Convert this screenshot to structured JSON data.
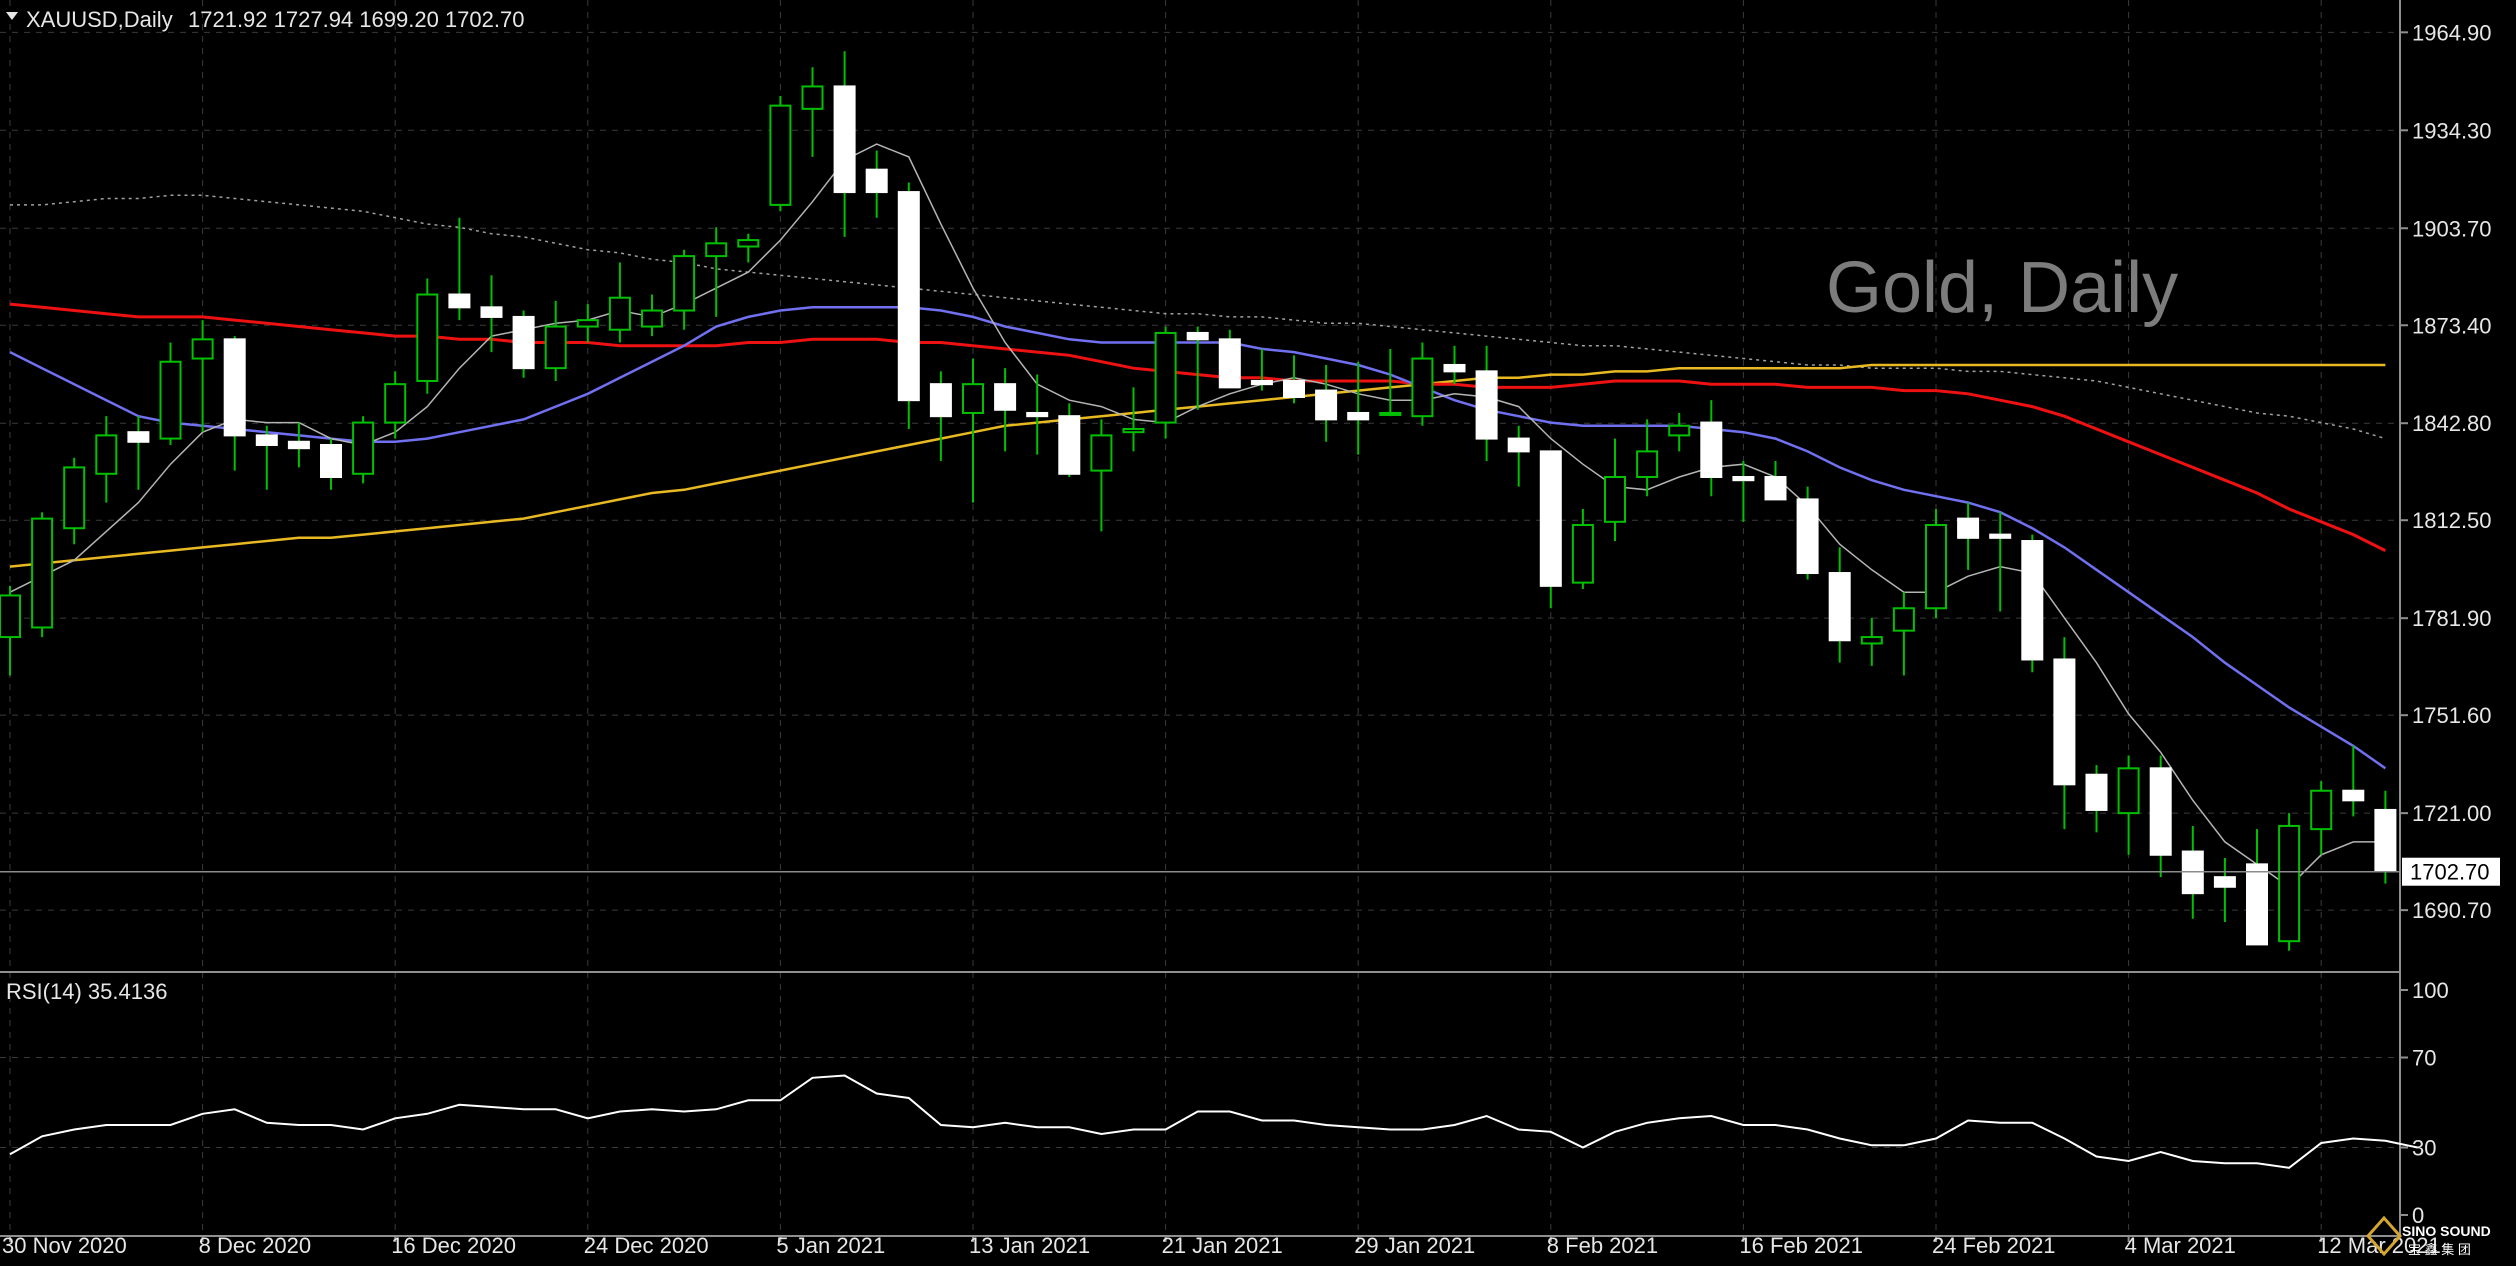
{
  "header": {
    "symbol": "XAUUSD,Daily",
    "ohlc": "1721.92 1727.94 1699.20 1702.70",
    "watermark": "Gold, Daily",
    "last_price": "1702.70"
  },
  "rsi_panel": {
    "label": "RSI(14) 35.4136",
    "levels": [
      "100",
      "70",
      "30",
      "0"
    ]
  },
  "logo": {
    "line1": "SINO SOUND",
    "line2": "宝 鑫 集 团"
  },
  "colors": {
    "background": "#000000",
    "bull_candle": "#000000",
    "bear_candle": "#ffffff",
    "wick": "#00c000",
    "ma_fast": "#b4b4b4",
    "ma_blue": "#7070f0",
    "ma_red": "#ee1111",
    "ma_yellow": "#e8b923",
    "ma_slow_dotted": "#a0a0a0",
    "rsi_line": "#ffffff"
  },
  "chart_data": {
    "type": "candlestick",
    "x_tick_labels": [
      "30 Nov 2020",
      "8 Dec 2020",
      "16 Dec 2020",
      "24 Dec 2020",
      "5 Jan 2021",
      "13 Jan 2021",
      "21 Jan 2021",
      "29 Jan 2021",
      "8 Feb 2021",
      "16 Feb 2021",
      "24 Feb 2021",
      "4 Mar 2021",
      "12 Mar 2021"
    ],
    "x_tick_index": [
      0,
      6,
      12,
      18,
      24,
      30,
      36,
      42,
      48,
      54,
      60,
      66,
      72
    ],
    "y_ticks": [
      1964.9,
      1934.3,
      1903.7,
      1873.4,
      1842.8,
      1812.5,
      1781.9,
      1751.6,
      1721.0,
      1690.7
    ],
    "ylim": [
      1672,
      1975
    ],
    "candles": [
      {
        "o": 1776,
        "h": 1792,
        "l": 1764,
        "c": 1789
      },
      {
        "o": 1779,
        "h": 1815,
        "l": 1776,
        "c": 1813
      },
      {
        "o": 1810,
        "h": 1832,
        "l": 1805,
        "c": 1829
      },
      {
        "o": 1827,
        "h": 1845,
        "l": 1818,
        "c": 1839
      },
      {
        "o": 1840,
        "h": 1845,
        "l": 1822,
        "c": 1837
      },
      {
        "o": 1838,
        "h": 1868,
        "l": 1836,
        "c": 1862
      },
      {
        "o": 1863,
        "h": 1875,
        "l": 1840,
        "c": 1869
      },
      {
        "o": 1869,
        "h": 1870,
        "l": 1828,
        "c": 1839
      },
      {
        "o": 1839,
        "h": 1842,
        "l": 1822,
        "c": 1836
      },
      {
        "o": 1837,
        "h": 1843,
        "l": 1829,
        "c": 1835
      },
      {
        "o": 1836,
        "h": 1838,
        "l": 1822,
        "c": 1826
      },
      {
        "o": 1827,
        "h": 1845,
        "l": 1824,
        "c": 1843
      },
      {
        "o": 1843,
        "h": 1859,
        "l": 1838,
        "c": 1855
      },
      {
        "o": 1856,
        "h": 1888,
        "l": 1852,
        "c": 1883
      },
      {
        "o": 1883,
        "h": 1907,
        "l": 1875,
        "c": 1879
      },
      {
        "o": 1879,
        "h": 1889,
        "l": 1865,
        "c": 1876
      },
      {
        "o": 1876,
        "h": 1878,
        "l": 1857,
        "c": 1860
      },
      {
        "o": 1860,
        "h": 1881,
        "l": 1856,
        "c": 1873
      },
      {
        "o": 1873,
        "h": 1880,
        "l": 1868,
        "c": 1875
      },
      {
        "o": 1872,
        "h": 1893,
        "l": 1868,
        "c": 1882
      },
      {
        "o": 1873,
        "h": 1883,
        "l": 1870,
        "c": 1878
      },
      {
        "o": 1878,
        "h": 1897,
        "l": 1872,
        "c": 1895
      },
      {
        "o": 1895,
        "h": 1904,
        "l": 1876,
        "c": 1899
      },
      {
        "o": 1898,
        "h": 1902,
        "l": 1893,
        "c": 1900
      },
      {
        "o": 1911,
        "h": 1945,
        "l": 1909,
        "c": 1942
      },
      {
        "o": 1941,
        "h": 1954,
        "l": 1926,
        "c": 1948
      },
      {
        "o": 1948,
        "h": 1959,
        "l": 1901,
        "c": 1915
      },
      {
        "o": 1922,
        "h": 1928,
        "l": 1907,
        "c": 1915
      },
      {
        "o": 1915,
        "h": 1918,
        "l": 1841,
        "c": 1850
      },
      {
        "o": 1855,
        "h": 1859,
        "l": 1831,
        "c": 1845
      },
      {
        "o": 1846,
        "h": 1863,
        "l": 1818,
        "c": 1855
      },
      {
        "o": 1855,
        "h": 1860,
        "l": 1834,
        "c": 1847
      },
      {
        "o": 1846,
        "h": 1858,
        "l": 1833,
        "c": 1845
      },
      {
        "o": 1845,
        "h": 1849,
        "l": 1826,
        "c": 1827
      },
      {
        "o": 1828,
        "h": 1844,
        "l": 1809,
        "c": 1839
      },
      {
        "o": 1840,
        "h": 1854,
        "l": 1834,
        "c": 1841
      },
      {
        "o": 1843,
        "h": 1873,
        "l": 1838,
        "c": 1871
      },
      {
        "o": 1871,
        "h": 1873,
        "l": 1847,
        "c": 1869
      },
      {
        "o": 1869,
        "h": 1872,
        "l": 1857,
        "c": 1854
      },
      {
        "o": 1856,
        "h": 1866,
        "l": 1853,
        "c": 1855
      },
      {
        "o": 1856,
        "h": 1864,
        "l": 1849,
        "c": 1851
      },
      {
        "o": 1853,
        "h": 1861,
        "l": 1837,
        "c": 1844
      },
      {
        "o": 1846,
        "h": 1862,
        "l": 1833,
        "c": 1844
      },
      {
        "o": 1846,
        "h": 1866,
        "l": 1845,
        "c": 1846
      },
      {
        "o": 1845,
        "h": 1868,
        "l": 1842,
        "c": 1863
      },
      {
        "o": 1861,
        "h": 1867,
        "l": 1855,
        "c": 1859
      },
      {
        "o": 1859,
        "h": 1867,
        "l": 1831,
        "c": 1838
      },
      {
        "o": 1838,
        "h": 1842,
        "l": 1823,
        "c": 1834
      },
      {
        "o": 1834,
        "h": 1834,
        "l": 1785,
        "c": 1792
      },
      {
        "o": 1793,
        "h": 1816,
        "l": 1791,
        "c": 1811
      },
      {
        "o": 1812,
        "h": 1838,
        "l": 1806,
        "c": 1826
      },
      {
        "o": 1826,
        "h": 1844,
        "l": 1820,
        "c": 1834
      },
      {
        "o": 1839,
        "h": 1846,
        "l": 1834,
        "c": 1842
      },
      {
        "o": 1843,
        "h": 1850,
        "l": 1820,
        "c": 1826
      },
      {
        "o": 1826,
        "h": 1831,
        "l": 1812,
        "c": 1825
      },
      {
        "o": 1826,
        "h": 1831,
        "l": 1819,
        "c": 1819
      },
      {
        "o": 1819,
        "h": 1823,
        "l": 1794,
        "c": 1796
      },
      {
        "o": 1796,
        "h": 1804,
        "l": 1768,
        "c": 1775
      },
      {
        "o": 1774,
        "h": 1782,
        "l": 1767,
        "c": 1776
      },
      {
        "o": 1778,
        "h": 1790,
        "l": 1764,
        "c": 1785
      },
      {
        "o": 1785,
        "h": 1816,
        "l": 1782,
        "c": 1811
      },
      {
        "o": 1813,
        "h": 1818,
        "l": 1797,
        "c": 1807
      },
      {
        "o": 1808,
        "h": 1815,
        "l": 1784,
        "c": 1807
      },
      {
        "o": 1806,
        "h": 1808,
        "l": 1765,
        "c": 1769
      },
      {
        "o": 1769,
        "h": 1776,
        "l": 1716,
        "c": 1730
      },
      {
        "o": 1733,
        "h": 1736,
        "l": 1715,
        "c": 1722
      },
      {
        "o": 1721,
        "h": 1739,
        "l": 1708,
        "c": 1735
      },
      {
        "o": 1735,
        "h": 1739,
        "l": 1701,
        "c": 1708
      },
      {
        "o": 1709,
        "h": 1717,
        "l": 1688,
        "c": 1696
      },
      {
        "o": 1701,
        "h": 1707,
        "l": 1687,
        "c": 1698
      },
      {
        "o": 1705,
        "h": 1716,
        "l": 1680,
        "c": 1680
      },
      {
        "o": 1681,
        "h": 1721,
        "l": 1678,
        "c": 1717
      },
      {
        "o": 1716,
        "h": 1731,
        "l": 1708,
        "c": 1728
      },
      {
        "o": 1728,
        "h": 1742,
        "l": 1720,
        "c": 1725
      },
      {
        "o": 1722,
        "h": 1728,
        "l": 1699,
        "c": 1703
      }
    ],
    "ma_fast": [
      1790,
      1795,
      1800,
      1809,
      1818,
      1830,
      1840,
      1844,
      1843,
      1843,
      1838,
      1836,
      1840,
      1848,
      1860,
      1870,
      1872,
      1874,
      1875,
      1878,
      1876,
      1880,
      1885,
      1890,
      1900,
      1912,
      1925,
      1930,
      1926,
      1905,
      1885,
      1868,
      1855,
      1850,
      1848,
      1844,
      1843,
      1848,
      1852,
      1855,
      1857,
      1855,
      1852,
      1850,
      1850,
      1852,
      1851,
      1848,
      1838,
      1830,
      1823,
      1822,
      1826,
      1829,
      1830,
      1826,
      1817,
      1805,
      1797,
      1790,
      1790,
      1795,
      1798,
      1796,
      1782,
      1768,
      1752,
      1740,
      1725,
      1712,
      1705,
      1698,
      1708,
      1712,
      1712
    ],
    "ma_blue": [
      1865,
      1860,
      1855,
      1850,
      1845,
      1843,
      1842,
      1841,
      1840,
      1839,
      1838,
      1837,
      1837,
      1838,
      1840,
      1842,
      1844,
      1848,
      1852,
      1857,
      1862,
      1867,
      1873,
      1876,
      1878,
      1879,
      1879,
      1879,
      1879,
      1878,
      1876,
      1873,
      1871,
      1869,
      1868,
      1868,
      1868,
      1868,
      1868,
      1866,
      1865,
      1863,
      1861,
      1858,
      1854,
      1850,
      1847,
      1845,
      1843,
      1842,
      1842,
      1842,
      1842,
      1841,
      1840,
      1838,
      1834,
      1829,
      1825,
      1822,
      1820,
      1818,
      1815,
      1810,
      1804,
      1797,
      1790,
      1783,
      1776,
      1768,
      1761,
      1754,
      1748,
      1742,
      1735
    ],
    "ma_red": [
      1880,
      1879,
      1878,
      1877,
      1876,
      1876,
      1876,
      1875,
      1874,
      1873,
      1872,
      1871,
      1870,
      1870,
      1869,
      1869,
      1868,
      1868,
      1868,
      1867,
      1867,
      1867,
      1867,
      1868,
      1868,
      1869,
      1869,
      1869,
      1868,
      1868,
      1867,
      1866,
      1865,
      1864,
      1862,
      1860,
      1859,
      1858,
      1857,
      1857,
      1856,
      1856,
      1856,
      1856,
      1855,
      1855,
      1854,
      1854,
      1854,
      1855,
      1856,
      1856,
      1856,
      1855,
      1855,
      1855,
      1854,
      1854,
      1854,
      1853,
      1853,
      1852,
      1850,
      1848,
      1845,
      1841,
      1837,
      1833,
      1829,
      1825,
      1821,
      1816,
      1812,
      1808,
      1803
    ],
    "ma_yellow": [
      1798,
      1799,
      1800,
      1801,
      1802,
      1803,
      1804,
      1805,
      1806,
      1807,
      1807,
      1808,
      1809,
      1810,
      1811,
      1812,
      1813,
      1815,
      1817,
      1819,
      1821,
      1822,
      1824,
      1826,
      1828,
      1830,
      1832,
      1834,
      1836,
      1838,
      1840,
      1842,
      1843,
      1844,
      1845,
      1846,
      1847,
      1848,
      1849,
      1850,
      1851,
      1852,
      1853,
      1854,
      1855,
      1856,
      1857,
      1857,
      1858,
      1858,
      1859,
      1859,
      1860,
      1860,
      1860,
      1860,
      1860,
      1860,
      1861,
      1861,
      1861,
      1861,
      1861,
      1861,
      1861,
      1861,
      1861,
      1861,
      1861,
      1861,
      1861,
      1861,
      1861,
      1861,
      1861
    ],
    "ma_slow_dotted": [
      1911,
      1911,
      1912,
      1913,
      1913,
      1914,
      1914,
      1913,
      1912,
      1911,
      1910,
      1909,
      1907,
      1905,
      1904,
      1902,
      1901,
      1899,
      1897,
      1896,
      1894,
      1893,
      1891,
      1890,
      1889,
      1888,
      1887,
      1886,
      1885,
      1884,
      1883,
      1882,
      1881,
      1880,
      1879,
      1878,
      1877,
      1877,
      1876,
      1876,
      1875,
      1874,
      1874,
      1873,
      1872,
      1871,
      1870,
      1869,
      1868,
      1867,
      1867,
      1866,
      1865,
      1864,
      1863,
      1862,
      1861,
      1861,
      1860,
      1860,
      1860,
      1859,
      1859,
      1858,
      1857,
      1856,
      1854,
      1852,
      1850,
      1848,
      1846,
      1845,
      1843,
      1841,
      1838
    ],
    "rsi": {
      "label": "RSI(14)",
      "ylim": [
        0,
        100
      ],
      "levels": [
        70,
        30
      ],
      "values": [
        27,
        35,
        38,
        40,
        40,
        40,
        45,
        47,
        41,
        40,
        40,
        38,
        43,
        45,
        49,
        48,
        47,
        47,
        43,
        46,
        47,
        46,
        47,
        51,
        51,
        61,
        62,
        54,
        52,
        40,
        39,
        41,
        39,
        39,
        36,
        38,
        38,
        46,
        46,
        42,
        42,
        40,
        39,
        38,
        38,
        40,
        44,
        38,
        37,
        30,
        37,
        41,
        43,
        44,
        40,
        40,
        38,
        34,
        31,
        31,
        34,
        42,
        41,
        41,
        34,
        26,
        24,
        28,
        24,
        23,
        23,
        21,
        32,
        34,
        33,
        30
      ]
    }
  }
}
